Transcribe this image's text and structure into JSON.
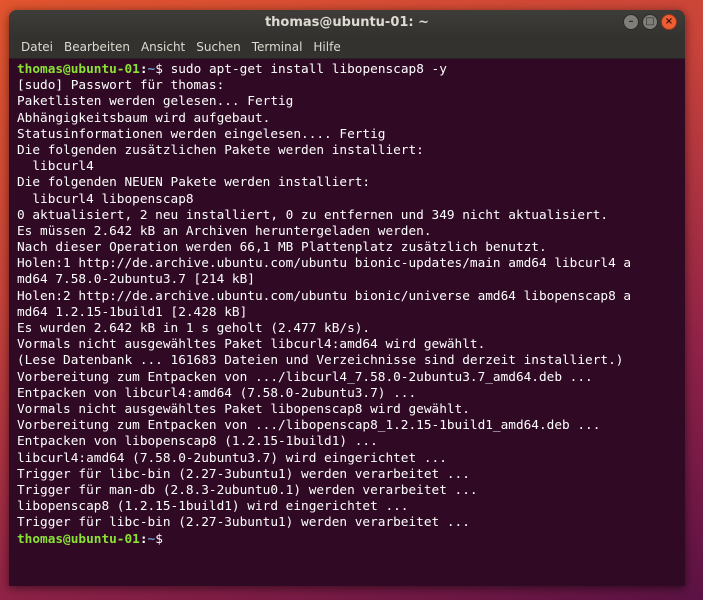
{
  "window": {
    "title": "thomas@ubuntu-01: ~",
    "controls": {
      "minimize_glyph": "–",
      "maximize_glyph": "□",
      "close_glyph": "×"
    }
  },
  "menu": {
    "items": [
      "Datei",
      "Bearbeiten",
      "Ansicht",
      "Suchen",
      "Terminal",
      "Hilfe"
    ]
  },
  "terminal": {
    "prompt_user": "thomas@ubuntu-01",
    "prompt_colon": ":",
    "prompt_path": "~",
    "prompt_symbol": "$ ",
    "command": "sudo apt-get install libopenscap8 -y",
    "output": [
      "[sudo] Passwort für thomas:",
      "Paketlisten werden gelesen... Fertig",
      "Abhängigkeitsbaum wird aufgebaut.",
      "Statusinformationen werden eingelesen.... Fertig",
      "Die folgenden zusätzlichen Pakete werden installiert:",
      "  libcurl4",
      "Die folgenden NEUEN Pakete werden installiert:",
      "  libcurl4 libopenscap8",
      "0 aktualisiert, 2 neu installiert, 0 zu entfernen und 349 nicht aktualisiert.",
      "Es müssen 2.642 kB an Archiven heruntergeladen werden.",
      "Nach dieser Operation werden 66,1 MB Plattenplatz zusätzlich benutzt.",
      "Holen:1 http://de.archive.ubuntu.com/ubuntu bionic-updates/main amd64 libcurl4 a",
      "md64 7.58.0-2ubuntu3.7 [214 kB]",
      "Holen:2 http://de.archive.ubuntu.com/ubuntu bionic/universe amd64 libopenscap8 a",
      "md64 1.2.15-1build1 [2.428 kB]",
      "Es wurden 2.642 kB in 1 s geholt (2.477 kB/s).",
      "Vormals nicht ausgewähltes Paket libcurl4:amd64 wird gewählt.",
      "(Lese Datenbank ... 161683 Dateien und Verzeichnisse sind derzeit installiert.)",
      "Vorbereitung zum Entpacken von .../libcurl4_7.58.0-2ubuntu3.7_amd64.deb ...",
      "Entpacken von libcurl4:amd64 (7.58.0-2ubuntu3.7) ...",
      "Vormals nicht ausgewähltes Paket libopenscap8 wird gewählt.",
      "Vorbereitung zum Entpacken von .../libopenscap8_1.2.15-1build1_amd64.deb ...",
      "Entpacken von libopenscap8 (1.2.15-1build1) ...",
      "libcurl4:amd64 (7.58.0-2ubuntu3.7) wird eingerichtet ...",
      "Trigger für libc-bin (2.27-3ubuntu1) werden verarbeitet ...",
      "Trigger für man-db (2.8.3-2ubuntu0.1) werden verarbeitet ...",
      "libopenscap8 (1.2.15-1build1) wird eingerichtet ...",
      "Trigger für libc-bin (2.27-3ubuntu1) werden verarbeitet ..."
    ]
  },
  "colors": {
    "terminal_background": "#300a24",
    "prompt_user": "#8ae234",
    "prompt_path": "#729fcf",
    "close_button": "#ef5e33"
  }
}
